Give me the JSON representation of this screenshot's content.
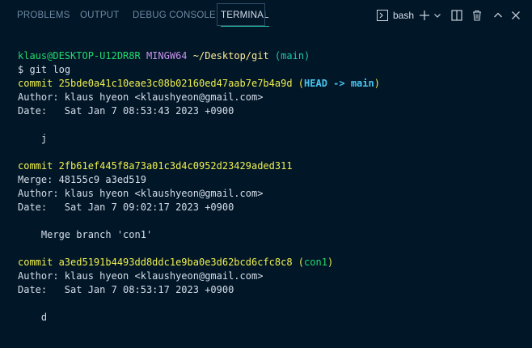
{
  "tabs": [
    {
      "label": "PROBLEMS",
      "active": false
    },
    {
      "label": "OUTPUT",
      "active": false
    },
    {
      "label": "DEBUG CONSOLE",
      "active": false
    },
    {
      "label": "TERMINAL",
      "active": true
    }
  ],
  "toolbar": {
    "shell_label": "bash",
    "icons": [
      "terminal-icon",
      "plus-icon",
      "chevron-down-icon",
      "split-icon",
      "trash-icon",
      "chevron-up-icon",
      "close-icon"
    ]
  },
  "colors": {
    "background": "#011627",
    "text": "#d6deeb",
    "prompt_user": "#22da6e",
    "prompt_mingw": "#c792ea",
    "prompt_path": "#ffeb95",
    "prompt_branch": "#21c7a8",
    "commit_hash": "#f0f04e",
    "ref_head": "#49c5f0",
    "ref_branch": "#22da6e"
  },
  "terminal": {
    "prompt": {
      "user_host": "klaus@DESKTOP-U12DR8R",
      "env": "MINGW64",
      "path": "~/Desktop/git",
      "branch": "(main)",
      "symbol": "$",
      "command": "git log"
    },
    "commits": [
      {
        "commit_line": "commit 25bde0a41c10eae3c08b02160ed47aab7e7b4a9d",
        "refs_open": "(",
        "ref_head": "HEAD -> main",
        "refs_close": ")",
        "merge": null,
        "author": "Author: klaus hyeon <klaushyeon@gmail.com>",
        "date": "Date:   Sat Jan 7 08:53:43 2023 +0900",
        "message": "    j"
      },
      {
        "commit_line": "commit 2fb61ef445f8a73a01c3d4c0952d23429aded311",
        "merge": "Merge: 48155c9 a3ed519",
        "author": "Author: klaus hyeon <klaushyeon@gmail.com>",
        "date": "Date:   Sat Jan 7 09:02:17 2023 +0900",
        "message": "    Merge branch 'con1'"
      },
      {
        "commit_line": "commit a3ed5191b4493dd8ddc1e9ba0e3d62bcd6cfc8c8",
        "refs_open": "(",
        "ref_branch": "con1",
        "refs_close": ")",
        "merge": null,
        "author": "Author: klaus hyeon <klaushyeon@gmail.com>",
        "date": "Date:   Sat Jan 7 08:53:17 2023 +0900",
        "message": "    d"
      }
    ]
  }
}
